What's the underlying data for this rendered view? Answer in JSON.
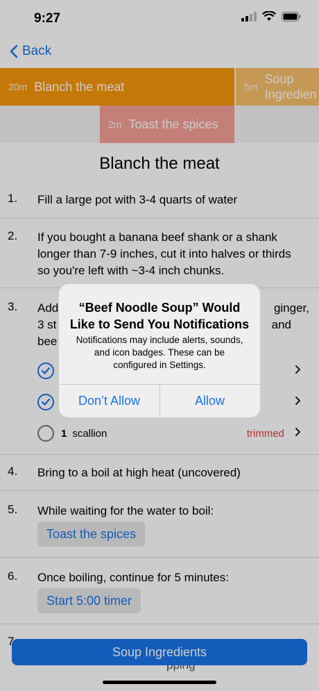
{
  "status": {
    "time": "9:27"
  },
  "nav": {
    "back_label": "Back"
  },
  "timeline": [
    {
      "duration": "20m",
      "name": "Blanch the meat"
    },
    {
      "duration": "5m",
      "name": "Soup Ingredien"
    },
    {
      "duration": "2m",
      "name": "Toast the spices"
    }
  ],
  "section": {
    "title": "Blanch the meat"
  },
  "steps": [
    {
      "num": "1.",
      "text": "Fill a large pot with 3-4 quarts of water"
    },
    {
      "num": "2.",
      "text": "If you bought a banana beef shank or a shank longer than 7-9 inches, cut it into halves or thirds so you're left with ~3-4 inch chunks."
    },
    {
      "num": "3.",
      "text_l1_start": "Add",
      "text_l1_end": "ginger,",
      "text_l2_start": "3 st",
      "text_l2_end": "and",
      "text_l3_start": "bee"
    },
    {
      "num": "4.",
      "text": "Bring to a boil at high heat (uncovered)"
    },
    {
      "num": "5.",
      "text": "While waiting for the water to boil:",
      "button": "Toast the spices"
    },
    {
      "num": "6.",
      "text": "Once boiling, continue for 5 minutes:",
      "button": "Start 5:00 timer"
    },
    {
      "num": "7",
      "text_partial": "pping"
    }
  ],
  "ingredients": [
    {
      "quantity": "1",
      "name": "scallion",
      "note": "trimmed"
    }
  ],
  "bottom_button": "Soup Ingredients",
  "alert": {
    "title": "“Beef Noodle Soup” Would Like to Send You Notifications",
    "message": "Notifications may include alerts, sounds, and icon badges. These can be configured in Settings.",
    "deny_label": "Don’t Allow",
    "allow_label": "Allow"
  },
  "colors": {
    "accent": "#1a73e8",
    "orange": "#f5970b",
    "light_orange": "#f7be6b",
    "salmon": "#f59f97",
    "note_red": "#e53935"
  }
}
